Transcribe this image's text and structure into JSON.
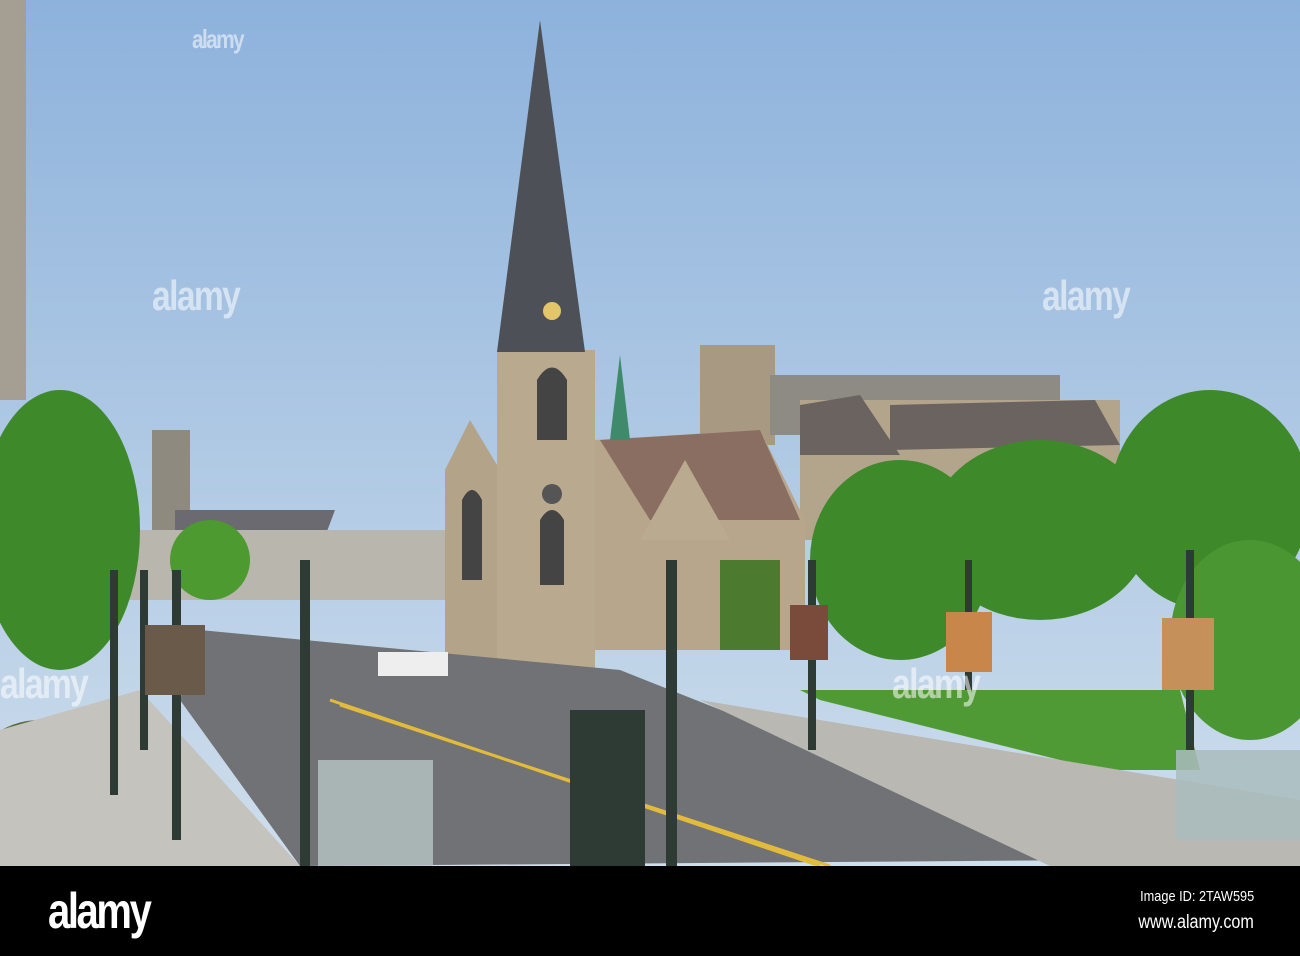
{
  "watermark": {
    "text": "alamy"
  },
  "footer": {
    "logo": "alamy",
    "image_id": "Image ID: 2TAW595",
    "website": "www.alamy.com"
  },
  "colors": {
    "sky_top": "#8fb3dc",
    "sky_bottom": "#c7d9ea",
    "stone": "#b9a98f",
    "spire": "#4d5056",
    "tree": "#3f8a2c",
    "road": "#6f7174"
  }
}
